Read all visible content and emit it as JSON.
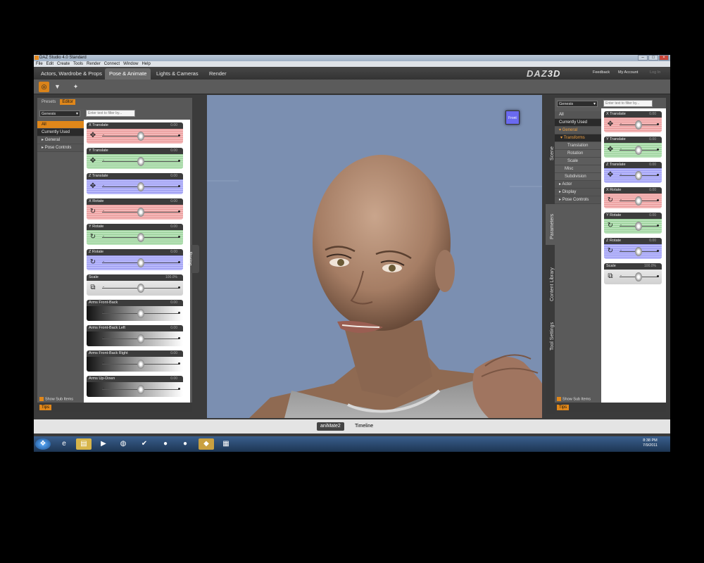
{
  "window": {
    "title": "DAZ Studio 4.0 Standard"
  },
  "menu": [
    "File",
    "Edit",
    "Create",
    "Tools",
    "Render",
    "Connect",
    "Window",
    "Help"
  ],
  "rooms": [
    "Actors, Wardrobe & Props",
    "Pose & Animate",
    "Lights & Cameras",
    "Render"
  ],
  "brand": {
    "logo_a": "DAZ",
    "logo_b": "3D",
    "feedback": "Feedback",
    "account": "My Account",
    "login": "Log In"
  },
  "left": {
    "tab_presets": "Presets",
    "tab_editor": "Editor",
    "figure": "Genesis",
    "search_placeholder": "Enter text to filter by...",
    "categories": [
      "All",
      "Currently Used",
      "General",
      "Pose Controls"
    ],
    "show_sub": "Show Sub Items",
    "tips": "Tips",
    "sliders": [
      {
        "label": "X Translate",
        "value": "0.00",
        "color": "red",
        "icon": "move-icon",
        "pos": 0.5
      },
      {
        "label": "Y Translate",
        "value": "0.00",
        "color": "green",
        "icon": "move-icon",
        "pos": 0.5
      },
      {
        "label": "Z Translate",
        "value": "0.00",
        "color": "blue",
        "icon": "move-icon",
        "pos": 0.5
      },
      {
        "label": "X Rotate",
        "value": "0.00",
        "color": "red",
        "icon": "rotate-icon",
        "pos": 0.5
      },
      {
        "label": "Y Rotate",
        "value": "0.00",
        "color": "green",
        "icon": "rotate-icon",
        "pos": 0.5
      },
      {
        "label": "Z Rotate",
        "value": "0.00",
        "color": "blue",
        "icon": "rotate-icon",
        "pos": 0.5
      },
      {
        "label": "Scale",
        "value": "100.0%",
        "color": "gray",
        "icon": "scale-icon",
        "pos": 0.5
      },
      {
        "label": "Arms Front-Back",
        "value": "0.00",
        "color": "morph",
        "icon": "",
        "pos": 0.5
      },
      {
        "label": "Arms Front-Back Left",
        "value": "0.00",
        "color": "morph",
        "icon": "",
        "pos": 0.5
      },
      {
        "label": "Arms Front-Back Right",
        "value": "0.00",
        "color": "morph",
        "icon": "",
        "pos": 0.5
      },
      {
        "label": "Arms Up-Down",
        "value": "0.00",
        "color": "morph",
        "icon": "",
        "pos": 0.5
      }
    ]
  },
  "posing_tab": "Posing",
  "cube_label": "Front",
  "side_tabs": [
    "Scene",
    "Parameters",
    "Content Library",
    "Tool Settings"
  ],
  "right": {
    "figure": "Genesis",
    "search_placeholder": "Enter text to filter by...",
    "tree": {
      "all": "All",
      "used": "Currently Used",
      "general": "General",
      "transforms": "Transforms",
      "translation": "Translation",
      "rotation": "Rotation",
      "scale": "Scale",
      "misc": "Misc",
      "subdivision": "Subdivision",
      "actor": "Actor",
      "display": "Display",
      "pose_controls": "Pose Controls"
    },
    "show_sub": "Show Sub Items",
    "tips": "Tips",
    "sliders": [
      {
        "label": "X Translate",
        "value": "0.00",
        "color": "red",
        "icon": "move-icon",
        "pos": 0.5
      },
      {
        "label": "Y Translate",
        "value": "0.00",
        "color": "green",
        "icon": "move-icon",
        "pos": 0.5
      },
      {
        "label": "Z Translate",
        "value": "0.00",
        "color": "blue",
        "icon": "move-icon",
        "pos": 0.5
      },
      {
        "label": "X Rotate",
        "value": "0.00",
        "color": "red",
        "icon": "rotate-icon",
        "pos": 0.5
      },
      {
        "label": "Y Rotate",
        "value": "0.00",
        "color": "green",
        "icon": "rotate-icon",
        "pos": 0.5
      },
      {
        "label": "Z Rotate",
        "value": "0.00",
        "color": "blue",
        "icon": "rotate-icon",
        "pos": 0.5
      },
      {
        "label": "Scale",
        "value": "100.0%",
        "color": "gray",
        "icon": "scale-icon",
        "pos": 0.5
      }
    ]
  },
  "bottom_tabs": [
    "aniMate2",
    "Timeline"
  ],
  "clock": {
    "time": "8:38 PM",
    "date": "7/9/2011"
  },
  "colors": {
    "accent": "#e0871a",
    "viewport": "#7b8fb1"
  }
}
